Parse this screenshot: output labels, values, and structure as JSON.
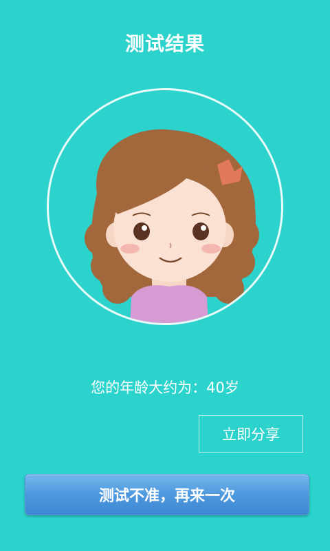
{
  "header": {
    "title": "测试结果"
  },
  "avatar": {
    "description_icon": "girl-avatar-icon"
  },
  "result": {
    "text": "您的年龄大约为：40岁"
  },
  "actions": {
    "share_label": "立即分享",
    "retest_label": "测试不准，再来一次"
  },
  "colors": {
    "background": "#2bd3cc",
    "button_blue": "#4e98de",
    "text": "#ffffff"
  }
}
